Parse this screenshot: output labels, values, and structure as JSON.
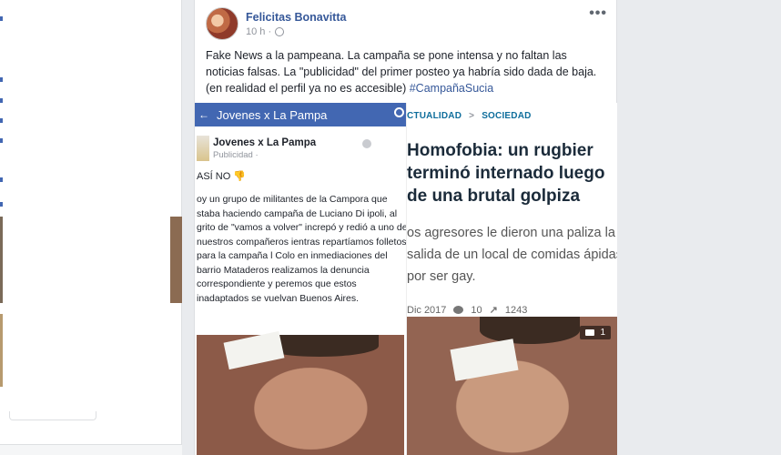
{
  "post": {
    "author": "Felicitas Bonavitta",
    "time": "10 h ·",
    "text": "Fake News a la pampeana. La campaña se pone intensa y no faltan las noticias falsas. La \"publicidad\" del primer posteo ya habría sido dada de baja. (en realidad el perfil ya no es accesible) ",
    "hashtag": "#CampañaSucia",
    "more": "•••"
  },
  "left_shot": {
    "bar_title": "Jovenes x La Pampa",
    "page_name": "Jovenes x La Pampa",
    "audience": "Publicidad ·",
    "headline": "ASÍ NO 👎",
    "body": "oy un grupo de militantes de la Campora que staba haciendo campaña de Luciano Di ipoli, al grito de \"vamos a volver\" increpó y redió a uno de nuestros compañeros ientras repartíamos folletos para la campaña l Colo en inmediaciones del barrio Mataderos realizamos la denuncia correspondiente y peremos que estos inadaptados se vuelvan Buenos Aires."
  },
  "right_shot": {
    "crumb1": "CTUALIDAD",
    "crumb_sep": ">",
    "crumb2": "SOCIEDAD",
    "headline": "Homofobia: un rugbier terminó internado luego de una brutal golpiza",
    "lead": "os agresores le dieron una paliza la salida de un local de comidas ápidas por ser gay.",
    "date": "Dic 2017",
    "comments": "10",
    "shares": "1243",
    "photo_count": "1"
  }
}
